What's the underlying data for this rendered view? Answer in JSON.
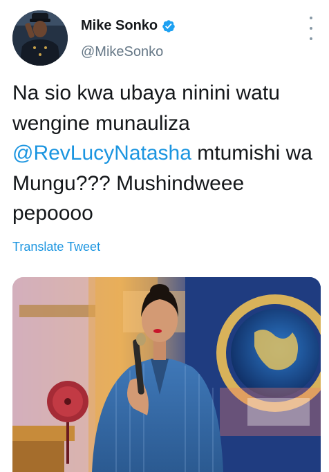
{
  "user": {
    "display_name": "Mike Sonko",
    "handle": "@MikeSonko",
    "verified": true
  },
  "icons": {
    "verified": "verified-badge-icon",
    "more": "more-options-icon"
  },
  "tweet": {
    "text_before": "Na sio kwa ubaya ninini watu wengine munauliza ",
    "mention": "@RevLucyNatasha",
    "text_after": " mtumishi wa Mungu??? Mushindweee pepoooo",
    "translate_label": "Translate Tweet"
  },
  "media": {
    "image_description": "Woman in blue pinstripe suit speaking into microphone on stage"
  },
  "colors": {
    "link": "#1b95e0",
    "verified": "#1da1f2",
    "secondary_text": "#657786"
  }
}
